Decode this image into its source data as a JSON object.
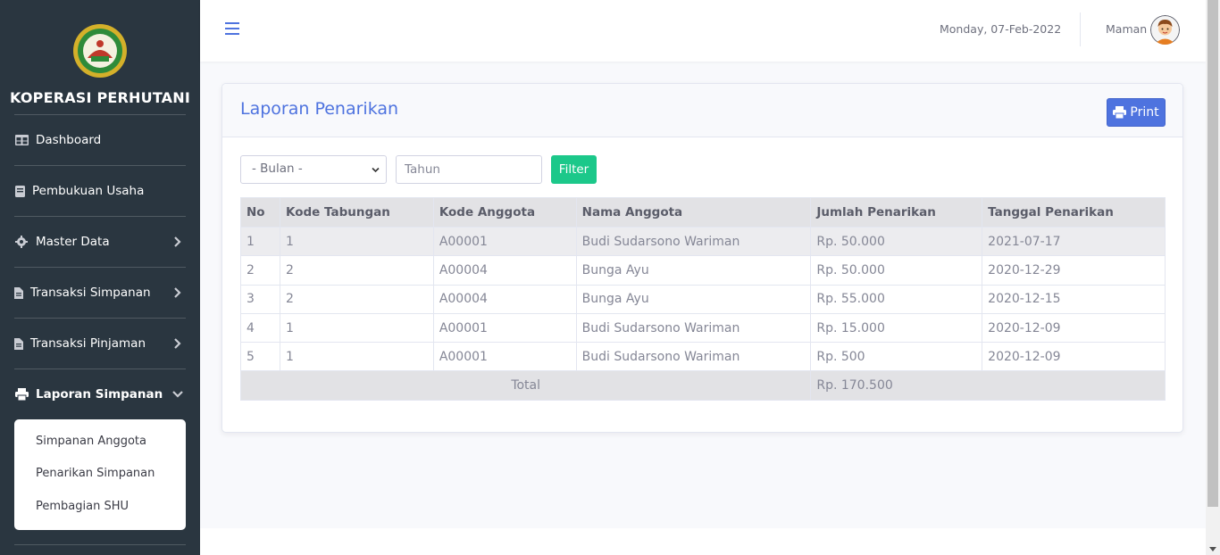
{
  "sidebar": {
    "brand": "KOPERASI PERHUTANI",
    "items": [
      {
        "label": "Dashboard"
      },
      {
        "label": "Pembukuan Usaha"
      },
      {
        "label": "Master Data"
      },
      {
        "label": "Transaksi Simpanan"
      },
      {
        "label": "Transaksi Pinjaman"
      },
      {
        "label": "Laporan Simpanan"
      }
    ],
    "submenu": [
      {
        "label": "Simpanan Anggota"
      },
      {
        "label": "Penarikan Simpanan"
      },
      {
        "label": "Pembagian SHU"
      }
    ]
  },
  "topbar": {
    "date": "Monday, 07-Feb-2022",
    "username": "Maman"
  },
  "card": {
    "title": "Laporan Penarikan",
    "print_label": "Print"
  },
  "filter": {
    "month_selected": "- Bulan -",
    "year_placeholder": "Tahun",
    "filter_label": "Filter"
  },
  "table": {
    "headers": [
      "No",
      "Kode Tabungan",
      "Kode Anggota",
      "Nama Anggota",
      "Jumlah Penarikan",
      "Tanggal Penarikan"
    ],
    "rows": [
      [
        "1",
        "1",
        "A00001",
        "Budi Sudarsono Wariman",
        "Rp. 50.000",
        "2021-07-17"
      ],
      [
        "2",
        "2",
        "A00004",
        "Bunga Ayu",
        "Rp. 50.000",
        "2020-12-29"
      ],
      [
        "3",
        "2",
        "A00004",
        "Bunga Ayu",
        "Rp. 55.000",
        "2020-12-15"
      ],
      [
        "4",
        "1",
        "A00001",
        "Budi Sudarsono Wariman",
        "Rp. 15.000",
        "2020-12-09"
      ],
      [
        "5",
        "1",
        "A00001",
        "Budi Sudarsono Wariman",
        "Rp. 500",
        "2020-12-09"
      ]
    ],
    "total_label": "Total",
    "total_value": "Rp. 170.500"
  },
  "colors": {
    "sidebar_bg": "#2a3640",
    "primary": "#4e73df",
    "success": "#1cc88a"
  },
  "icons": [
    "table-icon",
    "book-icon",
    "gear-icon",
    "file-icon",
    "file-icon",
    "print-icon",
    "chevron-right-icon",
    "chevron-down-icon",
    "bars-icon"
  ]
}
